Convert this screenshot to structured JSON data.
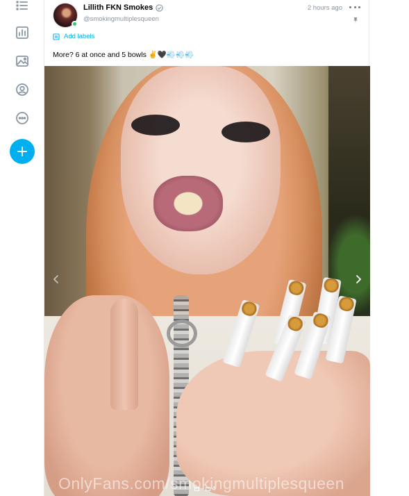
{
  "nav": {
    "items": [
      {
        "icon": "list-icon"
      },
      {
        "icon": "statistics-icon"
      },
      {
        "icon": "media-vault-icon"
      },
      {
        "icon": "profile-icon"
      },
      {
        "icon": "more-options-icon"
      }
    ],
    "new_post_icon": "plus-icon",
    "accent": "#00aff0"
  },
  "post": {
    "author_name": "Lillith FKN Smokes",
    "author_handle": "@smokingmultiplesqueen",
    "timestamp": "2 hours ago",
    "add_labels": "Add labels",
    "caption": "More? 6 at once and 5 bowls ✌️🖤💨💨💨",
    "media": {
      "watermark": "OnlyFans.com/smokingmultiplesqueen",
      "count": "4"
    }
  },
  "colors": {
    "accent": "#00aff0",
    "muted_text": "#8a96a3",
    "online": "#2ecc71"
  }
}
